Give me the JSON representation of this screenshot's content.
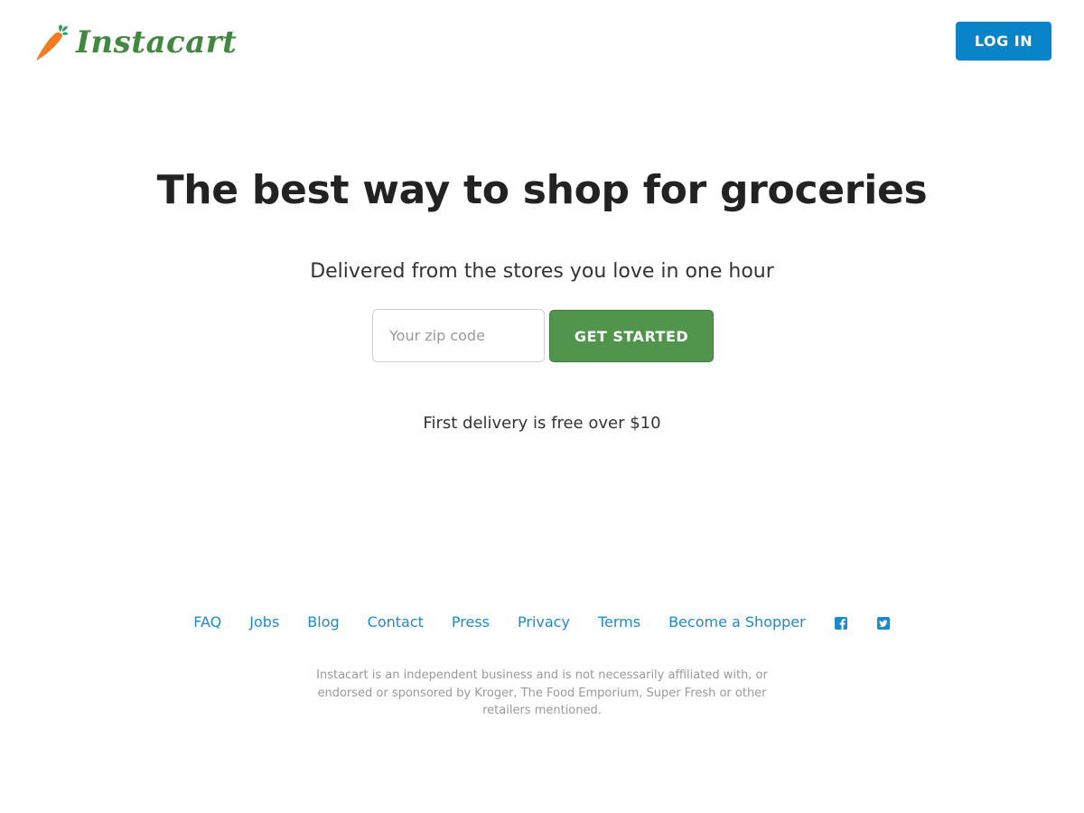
{
  "header": {
    "brand_name": "Instacart",
    "login_label": "LOG IN"
  },
  "hero": {
    "title": "The best way to shop for groceries",
    "subtitle": "Delivered from the stores you love in one hour",
    "zip_placeholder": "Your zip code",
    "zip_value": "",
    "cta_label": "GET STARTED",
    "note": "First delivery is free over $10"
  },
  "footer": {
    "links": [
      {
        "label": "FAQ"
      },
      {
        "label": "Jobs"
      },
      {
        "label": "Blog"
      },
      {
        "label": "Contact"
      },
      {
        "label": "Press"
      },
      {
        "label": "Privacy"
      },
      {
        "label": "Terms"
      },
      {
        "label": "Become a Shopper"
      }
    ],
    "social": [
      {
        "icon": "facebook-icon"
      },
      {
        "icon": "twitter-icon"
      }
    ],
    "disclaimer": "Instacart is an independent business and is not necessarily affiliated with, or endorsed or sponsored by Kroger, The Food Emporium, Super Fresh or other retailers mentioned."
  },
  "colors": {
    "brand_green": "#43883f",
    "carrot_orange": "#f47b20",
    "leaf_green": "#2f9e5a",
    "login_blue": "#0a84c8",
    "cta_green": "#50954b",
    "link_blue": "#1d8acb"
  }
}
